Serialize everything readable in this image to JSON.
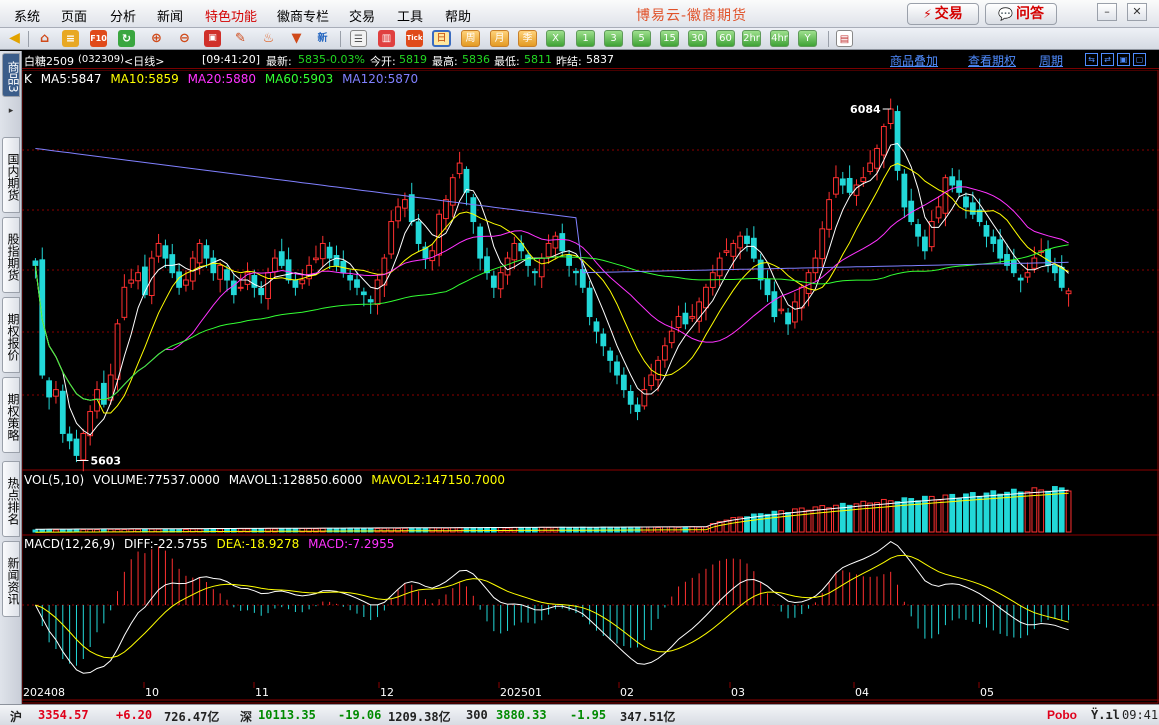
{
  "menu": {
    "items": [
      "系统",
      "页面",
      "分析",
      "新闻",
      "特色功能",
      "徽商专栏",
      "交易",
      "工具",
      "帮助"
    ],
    "app_title": "博易云-徽商期货",
    "trade_button": "交易",
    "ask_button": "问答"
  },
  "toolbar": {
    "periods": [
      "日",
      "周",
      "月",
      "季",
      "X",
      "1",
      "3",
      "5",
      "15",
      "30",
      "60",
      "2hr",
      "4hr",
      "Y"
    ],
    "active_period": "日"
  },
  "left_tabs": [
    "商品3",
    "国内期货",
    "股指期货",
    "期权报价",
    "期权策略",
    "热点排名",
    "新闻资讯"
  ],
  "info_bar": {
    "symbol": "白糖2509",
    "code": "(032309)",
    "period": "<日线>",
    "time": "[09:41:20]",
    "latest_label": "最新:",
    "latest": "5835",
    "change_pct": "-0.03%",
    "open_label": "今开:",
    "open": "5819",
    "high_label": "最高:",
    "high": "5836",
    "low_label": "最低:",
    "low": "5811",
    "prev_close_label": "昨结:",
    "prev_close": "5837",
    "links": [
      "商品叠加",
      "查看期权",
      "周期"
    ]
  },
  "main_legend": {
    "k": "K",
    "ma5": "MA5:5847",
    "ma10": "MA10:5859",
    "ma20": "MA20:5880",
    "ma60": "MA60:5903",
    "ma120": "MA120:5870",
    "high_marker": "6084",
    "low_marker": "5603"
  },
  "vol_legend": {
    "title": "VOL(5,10)",
    "volume": "VOLUME:77537.0000",
    "mavol1": "MAVOL1:128850.6000",
    "mavol2": "MAVOL2:147150.7000"
  },
  "macd_legend": {
    "title": "MACD(12,26,9)",
    "diff": "DIFF:-22.5755",
    "dea": "DEA:-18.9278",
    "macd": "MACD:-7.2955"
  },
  "x_axis_labels": [
    "202408",
    "10",
    "11",
    "12",
    "202501",
    "02",
    "03",
    "04",
    "05"
  ],
  "status_bar": {
    "sh_label": "沪",
    "sh_index": "3354.57",
    "sh_change": "+6.20",
    "sh_amount": "726.47亿",
    "sz_label": "深",
    "sz_index": "10113.35",
    "sz_change": "-19.06",
    "sz_amount": "1209.38亿",
    "c300_label": "300",
    "c300_index": "3880.33",
    "c300_change": "-1.95",
    "c300_amount": "347.51亿",
    "brand": "Pobo",
    "clock": "09:41"
  },
  "colors": {
    "up": "#ff3030",
    "down": "#22d8d8",
    "ma5": "#ffffff",
    "ma10": "#ffff00",
    "ma20": "#ff33ff",
    "ma60": "#33ff33",
    "ma120": "#8080ff",
    "grid": "#8b0000"
  },
  "chart_data": {
    "type": "candlestick",
    "symbol": "白糖2509",
    "period": "daily",
    "y_range_main": [
      5590,
      6110
    ],
    "max_label": 6084,
    "min_label": 5603,
    "last": {
      "open": 5819,
      "high": 5836,
      "low": 5811,
      "close": 5835,
      "prev_settle": 5837
    },
    "ma": {
      "MA5": 5847,
      "MA10": 5859,
      "MA20": 5880,
      "MA60": 5903,
      "MA120": 5870
    },
    "volume": {
      "VOLUME": 77537.0,
      "MAVOL1": 128850.6,
      "MAVOL2": 147150.7
    },
    "macd": {
      "DIFF": -22.5755,
      "DEA": -18.9278,
      "MACD": -7.2955
    },
    "x_ticks": [
      "202408",
      "10",
      "11",
      "12",
      "202501",
      "02",
      "03",
      "04",
      "05"
    ],
    "closes": [
      5870,
      5720,
      5690,
      5700,
      5640,
      5630,
      5610,
      5640,
      5670,
      5700,
      5680,
      5720,
      5790,
      5840,
      5850,
      5860,
      5830,
      5880,
      5900,
      5880,
      5860,
      5840,
      5850,
      5880,
      5900,
      5880,
      5860,
      5870,
      5850,
      5830,
      5840,
      5860,
      5840,
      5830,
      5860,
      5880,
      5870,
      5850,
      5840,
      5850,
      5870,
      5880,
      5900,
      5880,
      5870,
      5860,
      5850,
      5840,
      5830,
      5820,
      5850,
      5880,
      5930,
      5950,
      5960,
      5930,
      5900,
      5880,
      5890,
      5940,
      5960,
      5990,
      6010,
      5970,
      5930,
      5880,
      5860,
      5840,
      5860,
      5880,
      5900,
      5890,
      5870,
      5860,
      5880,
      5900,
      5910,
      5890,
      5870,
      5860,
      5840,
      5800,
      5780,
      5760,
      5740,
      5720,
      5700,
      5680,
      5670,
      5700,
      5720,
      5740,
      5760,
      5780,
      5800,
      5790,
      5800,
      5820,
      5840,
      5860,
      5880,
      5890,
      5900,
      5910,
      5900,
      5880,
      5850,
      5830,
      5800,
      5810,
      5790,
      5820,
      5840,
      5860,
      5880,
      5920,
      5960,
      5990,
      5980,
      5970,
      5980,
      5990,
      6010,
      6030,
      6060,
      6084,
      6000,
      5950,
      5930,
      5910,
      5890,
      5930,
      5950,
      5990,
      5980,
      5970,
      5950,
      5940,
      5930,
      5910,
      5900,
      5880,
      5870,
      5860,
      5850,
      5860,
      5880,
      5890,
      5870,
      5860,
      5840,
      5835
    ]
  }
}
